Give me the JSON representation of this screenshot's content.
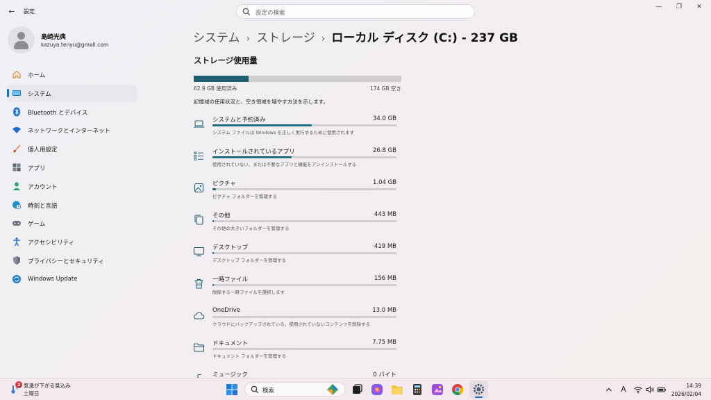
{
  "window": {
    "title": "設定",
    "back_glyph": "←",
    "controls": {
      "minimize": "—",
      "maximize": "❐",
      "close": "✕"
    }
  },
  "search": {
    "placeholder": "設定の検索"
  },
  "profile": {
    "name": "島崎光典",
    "email": "kazuya.tenyu@gmail.com"
  },
  "nav": [
    {
      "label": "ホーム",
      "icon": "home-icon",
      "color": "#e2863a"
    },
    {
      "label": "システム",
      "icon": "system-icon",
      "color": "#1e7fd0",
      "active": true
    },
    {
      "label": "Bluetooth とデバイス",
      "icon": "bluetooth-icon",
      "color": "#1e6fd0"
    },
    {
      "label": "ネットワークとインターネット",
      "icon": "wifi-icon",
      "color": "#1e6fd0"
    },
    {
      "label": "個人用設定",
      "icon": "brush-icon",
      "color": "#e27b3a"
    },
    {
      "label": "アプリ",
      "icon": "apps-icon",
      "color": "#5a6270"
    },
    {
      "label": "アカウント",
      "icon": "account-icon",
      "color": "#2ea47a"
    },
    {
      "label": "時刻と言語",
      "icon": "globe-clock-icon",
      "color": "#1e8fd0"
    },
    {
      "label": "ゲーム",
      "icon": "gamepad-icon",
      "color": "#6b7280"
    },
    {
      "label": "アクセシビリティ",
      "icon": "accessibility-icon",
      "color": "#1e6fd0"
    },
    {
      "label": "プライバシーとセキュリティ",
      "icon": "shield-icon",
      "color": "#6b7280"
    },
    {
      "label": "Windows Update",
      "icon": "update-icon",
      "color": "#1e7fd0"
    }
  ],
  "breadcrumb": {
    "level1": "システム",
    "level2": "ストレージ",
    "current": "ローカル ディスク (C:) - 237 GB",
    "separator": "›"
  },
  "storage": {
    "section_title": "ストレージ使用量",
    "used_label": "62.9 GB 使用済み",
    "free_label": "174 GB 空き",
    "used_fraction": 0.265,
    "description": "記憶域の使用状況と、空き領域を増やす方法を示します。",
    "categories": [
      {
        "name": "システムと予約済み",
        "size": "34.0 GB",
        "sub": "システム ファイルは Windows を正しく実行するために使用されます",
        "fraction": 0.54,
        "icon": "laptop-icon"
      },
      {
        "name": "インストールされているアプリ",
        "size": "26.8 GB",
        "sub": "使用されていない、または不要なアプリと機能をアンインストールする",
        "fraction": 0.43,
        "icon": "apps-list-icon"
      },
      {
        "name": "ピクチャ",
        "size": "1.04 GB",
        "sub": "ピクチャ フォルダーを管理する",
        "fraction": 0.017,
        "icon": "picture-icon"
      },
      {
        "name": "その他",
        "size": "443 MB",
        "sub": "その他の大きいフォルダーを管理する",
        "fraction": 0.007,
        "icon": "other-files-icon"
      },
      {
        "name": "デスクトップ",
        "size": "419 MB",
        "sub": "デスクトップ フォルダーを管理する",
        "fraction": 0.007,
        "icon": "desktop-icon"
      },
      {
        "name": "一時ファイル",
        "size": "156 MB",
        "sub": "削除する一時ファイルを選択します",
        "fraction": 0.003,
        "icon": "trash-icon"
      },
      {
        "name": "OneDrive",
        "size": "13.0 MB",
        "sub": "クラウドにバックアップされている、使用されていないコンテンツを削除する",
        "fraction": 0.0,
        "icon": "cloud-icon"
      },
      {
        "name": "ドキュメント",
        "size": "7.75 MB",
        "sub": "ドキュメント フォルダーを管理する",
        "fraction": 0.0,
        "icon": "folder-icon"
      },
      {
        "name": "ミュージック",
        "size": "0 バイト",
        "sub": "",
        "fraction": 0.0,
        "icon": "music-icon"
      }
    ]
  },
  "taskbar": {
    "weather_line1": "気温が下がる見込み",
    "weather_line2": "土曜日",
    "weather_badge": "2",
    "search_placeholder": "検索",
    "tray_font_glyph": "A",
    "clock_time": "14:39",
    "clock_date": "2026/02/04"
  }
}
